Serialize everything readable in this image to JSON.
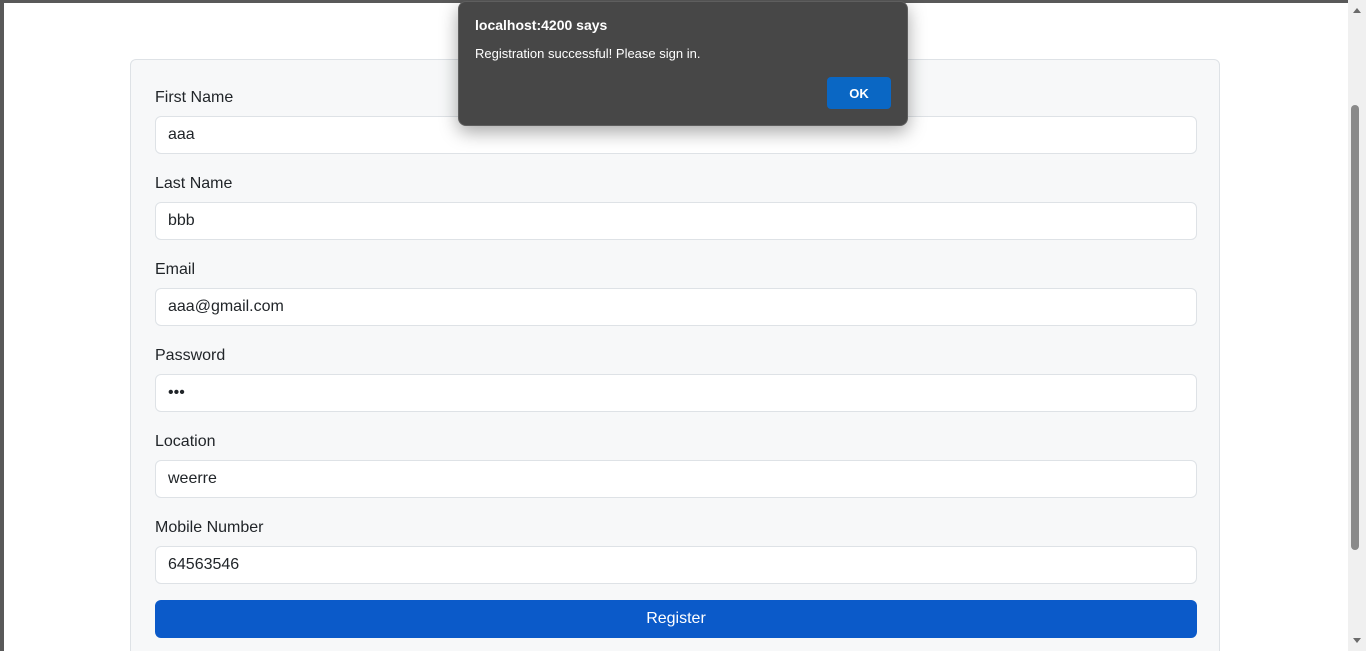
{
  "form": {
    "fields": [
      {
        "label": "First Name",
        "value": "aaa"
      },
      {
        "label": "Last Name",
        "value": "bbb"
      },
      {
        "label": "Email",
        "value": "aaa@gmail.com"
      },
      {
        "label": "Password",
        "value": "•••"
      },
      {
        "label": "Location",
        "value": "weerre"
      },
      {
        "label": "Mobile Number",
        "value": "64563546"
      }
    ],
    "submit_label": "Register"
  },
  "alert": {
    "title": "localhost:4200 says",
    "message": "Registration successful! Please sign in.",
    "ok_label": "OK"
  },
  "colors": {
    "primary": "#0b5ac9",
    "dialog_background": "#474747",
    "dialog_button": "#0a67c4"
  }
}
